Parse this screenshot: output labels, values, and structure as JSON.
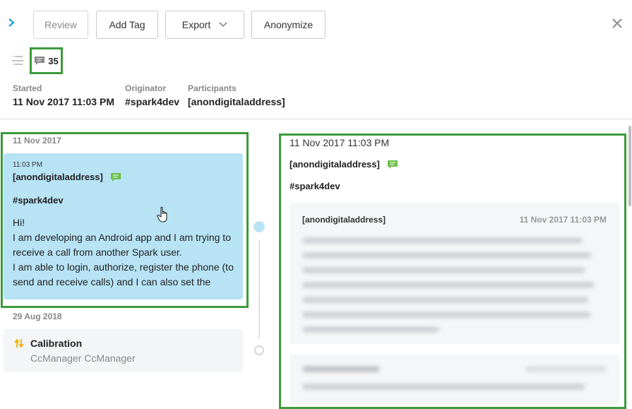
{
  "toolbar": {
    "expand_icon": "chevron-right-icon",
    "review_label": "Review",
    "add_tag_label": "Add Tag",
    "export_label": "Export",
    "anonymize_label": "Anonymize",
    "close_icon": "close-icon"
  },
  "summary": {
    "comment_count": "35"
  },
  "meta": {
    "started_label": "Started",
    "started_value": "11 Nov 2017 11:03 PM",
    "originator_label": "Originator",
    "originator_value": "#spark4dev",
    "participants_label": "Participants",
    "participants_value": "[anondigitaladdress]"
  },
  "timeline": {
    "groups": [
      {
        "date": "11 Nov 2017",
        "message": {
          "time": "11:03 PM",
          "from": "[anondigitaladdress]",
          "channel": "#spark4dev",
          "body": [
            "Hi!",
            "I am developing an Android app and I am trying to",
            "receive a call from another Spark user.",
            "I am able to login, authorize, register the phone (to",
            "send and receive calls) and I can also set the"
          ]
        }
      },
      {
        "date": "29 Aug 2018",
        "event": {
          "title": "Calibration",
          "subtitle": "CcManager CcManager"
        }
      }
    ]
  },
  "detail": {
    "date": "11 Nov 2017 11:03 PM",
    "from": "[anondigitaladdress]",
    "channel": "#spark4dev",
    "card": {
      "from": "[anondigitaladdress]",
      "date": "11 Nov 2017 11:03 PM"
    }
  },
  "colors": {
    "accent": "#1a9bd7",
    "highlight_border": "#3c9b3c",
    "message_bg": "#b7e3f5",
    "comment_icon": "#6cc04a"
  }
}
